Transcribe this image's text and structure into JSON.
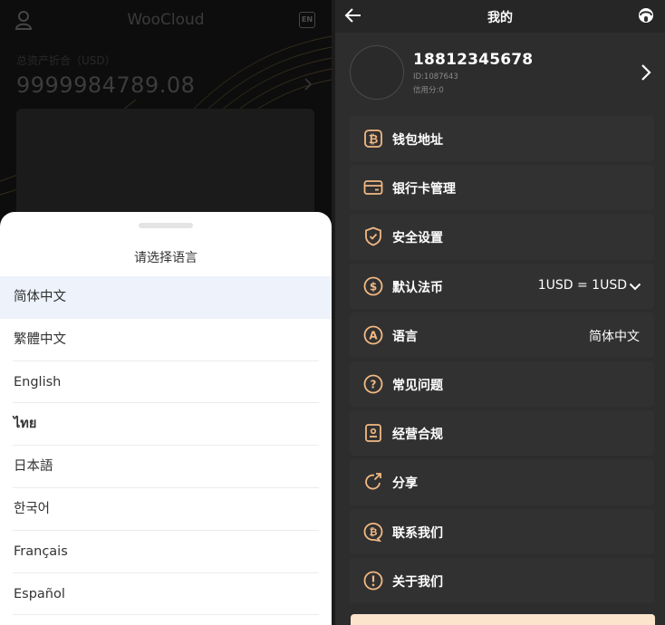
{
  "left": {
    "app_title": "WooCloud",
    "lang_badge": "EN",
    "asset_label": "总资产折合（USD）",
    "asset_value": "9999984789.08"
  },
  "language_sheet": {
    "title": "请选择语言",
    "selected": "简体中文",
    "options": [
      "简体中文",
      "繁體中文",
      "English",
      "ไทย",
      "日本語",
      "한국어",
      "Français",
      "Español"
    ]
  },
  "right": {
    "page_title": "我的",
    "profile": {
      "phone": "18812345678",
      "id_text": "ID:1087643",
      "credit_text": "信用分:0"
    },
    "menu": [
      {
        "label": "钱包地址",
        "icon": "bitcoin-wallet-icon",
        "value": ""
      },
      {
        "label": "银行卡管理",
        "icon": "bank-card-icon",
        "value": ""
      },
      {
        "label": "安全设置",
        "icon": "shield-icon",
        "value": ""
      },
      {
        "label": "默认法币",
        "icon": "dollar-circle-icon",
        "value": "1USD = 1USD"
      },
      {
        "label": "语言",
        "icon": "letter-a-circle-icon",
        "value": "简体中文"
      },
      {
        "label": "常见问题",
        "icon": "question-circle-icon",
        "value": ""
      },
      {
        "label": "经营合规",
        "icon": "license-icon",
        "value": ""
      },
      {
        "label": "分享",
        "icon": "share-icon",
        "value": ""
      },
      {
        "label": "联系我们",
        "icon": "contact-bitcoin-icon",
        "value": ""
      },
      {
        "label": "关于我们",
        "icon": "info-exclamation-icon",
        "value": ""
      }
    ]
  },
  "colors": {
    "accent_orange": "#f2b984",
    "sheet_selected_bg": "#edf2fb",
    "bottom_button_bg": "#fce3cc"
  }
}
